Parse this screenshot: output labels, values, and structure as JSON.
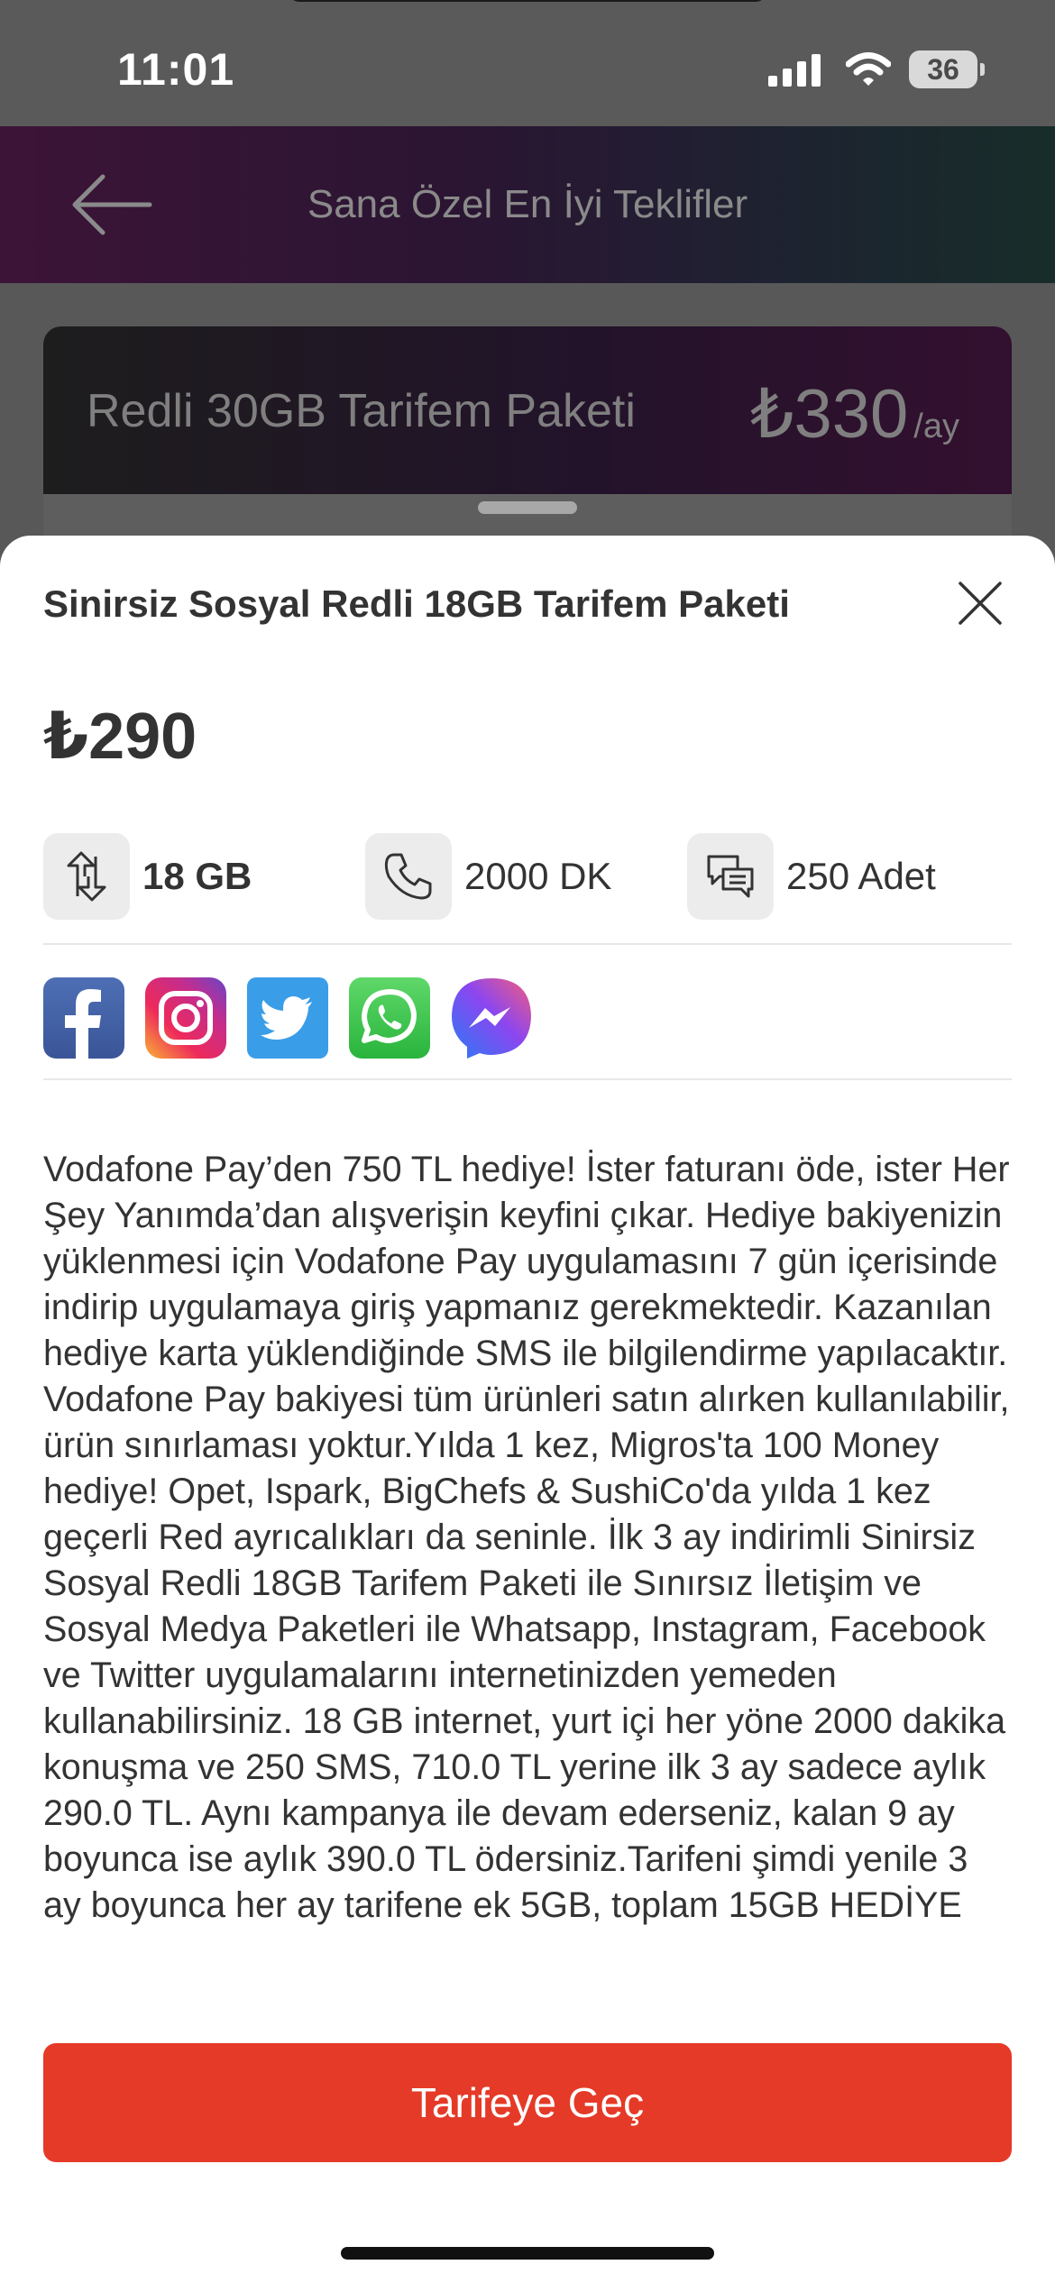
{
  "status_bar": {
    "time": "11:01",
    "battery_level": "36",
    "icons": [
      "signal-icon",
      "wifi-icon",
      "battery-icon"
    ]
  },
  "header": {
    "title": "Sana Özel En İyi Teklifler",
    "back_icon": "back-arrow-icon"
  },
  "background_card": {
    "title": "Redli 30GB Tarifem Paketi",
    "price": "₺330",
    "period": "/ay"
  },
  "sheet": {
    "title": "Sinirsiz Sosyal Redli 18GB Tarifem Paketi",
    "price": "₺290",
    "features": [
      {
        "icon": "data-transfer-icon",
        "label": "18 GB"
      },
      {
        "icon": "phone-icon",
        "label": "2000 DK"
      },
      {
        "icon": "chat-bubbles-icon",
        "label": "250 Adet"
      }
    ],
    "social_apps": [
      "facebook-icon",
      "instagram-icon",
      "twitter-icon",
      "whatsapp-icon",
      "messenger-icon"
    ],
    "description": "Vodafone Pay’den 750 TL hediye! İster faturanı öde, ister Her Şey Yanımda’dan alışverişin keyfini çıkar. Hediye bakiyenizin yüklenmesi için Vodafone Pay uygulamasını 7 gün içerisinde indirip uygulamaya giriş yapmanız gerekmektedir. Kazanılan hediye karta yüklendiğinde SMS ile bilgilendirme yapılacaktır. Vodafone Pay bakiyesi tüm ürünleri satın alırken kullanılabilir, ürün sınırlaması yoktur.Yılda 1 kez, Migros'ta 100 Money hediye! Opet, Ispark, BigChefs & SushiCo'da yılda 1 kez geçerli Red ayrıcalıkları da seninle. İlk 3 ay indirimli Sinirsiz Sosyal Redli 18GB Tarifem Paketi ile Sınırsız İletişim ve Sosyal Medya Paketleri ile Whatsapp, Instagram, Facebook ve Twitter  uygulamalarını internetinizden yemeden kullanabilirsiniz. 18 GB internet, yurt içi her yöne 2000 dakika konuşma ve 250 SMS, 710.0 TL yerine ilk 3 ay sadece aylık 290.0 TL. Aynı kampanya ile devam ederseniz, kalan 9 ay boyunca ise aylık 390.0 TL ödersiniz.Tarifeni şimdi yenile 3 ay boyunca her ay tarifene ek 5GB, toplam 15GB HEDİYE",
    "cta_label": "Tarifeye Geç"
  },
  "colors": {
    "cta_red": "#e53a27",
    "sheet_background": "#ffffff",
    "overlay": "#585858"
  }
}
